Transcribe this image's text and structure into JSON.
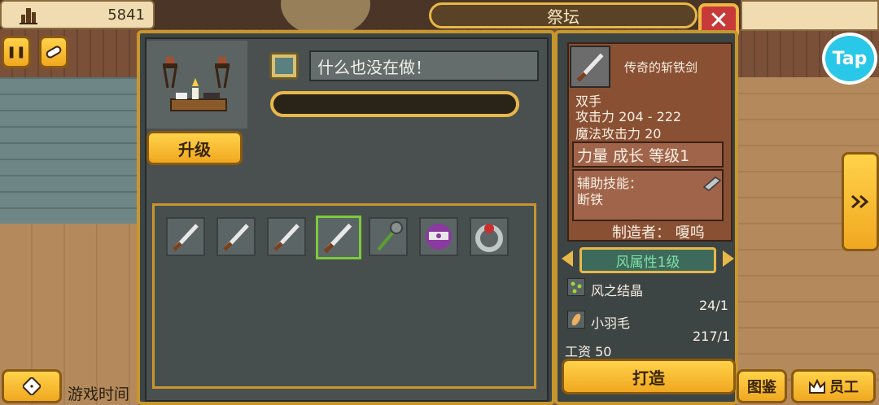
{
  "top_bar": {
    "coins": "5841",
    "title": "祭坛",
    "close_label": "✕"
  },
  "left_buttons": {
    "pause_label": "❚❚"
  },
  "altar": {
    "upgrade_label": "升级"
  },
  "status": {
    "text": "什么也没在做！",
    "progress": 0
  },
  "inventory": {
    "items": [
      {
        "icon": "sword-icon",
        "selected": false
      },
      {
        "icon": "sword-icon",
        "selected": false
      },
      {
        "icon": "sword-icon",
        "selected": false
      },
      {
        "icon": "sword-icon",
        "selected": true
      },
      {
        "icon": "staff-icon",
        "selected": false
      },
      {
        "icon": "crown-icon",
        "selected": false
      },
      {
        "icon": "ring-icon",
        "selected": false
      }
    ]
  },
  "item_detail": {
    "name": "传奇的斩铁剑",
    "hand": "双手",
    "attack": "攻击力 204 - 222",
    "magic_attack": "魔法攻击力 20",
    "stats": "力量 成长 等级1",
    "skill_label": "辅助技能：",
    "skill_name": "断铁",
    "maker": "制造者： 嗄呜"
  },
  "attribute": {
    "label": "风属性1级"
  },
  "materials": [
    {
      "name": "风之结晶",
      "count": "24/1",
      "icon": "wind-crystal-icon"
    },
    {
      "name": "小羽毛",
      "count": "217/1",
      "icon": "feather-icon"
    }
  ],
  "wage": "工资 50",
  "craft_label": "打造",
  "bottom": {
    "game_time": "游戏时间",
    "encyclopedia": "图鉴",
    "staff": "员工"
  },
  "tap_logo": "Tap",
  "colors": {
    "accent": "#e8b848",
    "selected": "#7acb3a",
    "close": "#c83a3a"
  }
}
